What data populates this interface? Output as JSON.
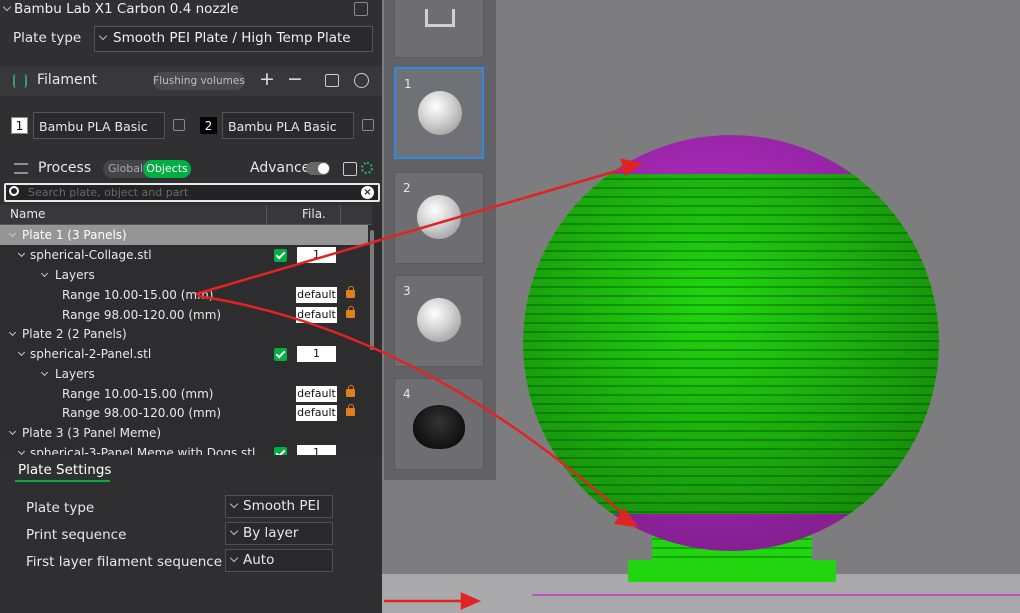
{
  "printer": {
    "name": "Bambu Lab X1 Carbon 0.4 nozzle"
  },
  "plate_type_row": {
    "label": "Plate type",
    "value": "Smooth PEI Plate / High Temp Plate"
  },
  "filament": {
    "title": "Filament",
    "flushing_label": "Flushing volumes",
    "add_symbol": "+",
    "remove_symbol": "−",
    "slots": [
      {
        "num": "1",
        "name": "Bambu PLA Basic",
        "color": "#ffffff"
      },
      {
        "num": "2",
        "name": "Bambu PLA Basic",
        "color": "#000000"
      }
    ]
  },
  "process": {
    "title": "Process",
    "global_label": "Global",
    "objects_label": "Objects",
    "advanced_label": "Advance"
  },
  "search": {
    "placeholder": "Search plate, object and part"
  },
  "tree": {
    "col_name": "Name",
    "col_fila": "Fila.",
    "rows": [
      {
        "text": "Plate 1 (3 Panels)"
      },
      {
        "text": "spherical-Collage.stl",
        "fila": "1"
      },
      {
        "text": "Layers"
      },
      {
        "text": "Range 10.00-15.00 (mm)",
        "fila": "default"
      },
      {
        "text": "Range 98.00-120.00 (mm)",
        "fila": "default"
      },
      {
        "text": "Plate 2 (2 Panels)"
      },
      {
        "text": "spherical-2-Panel.stl",
        "fila": "1"
      },
      {
        "text": "Layers"
      },
      {
        "text": "Range 10.00-15.00 (mm)",
        "fila": "default"
      },
      {
        "text": "Range 98.00-120.00 (mm)",
        "fila": "default"
      },
      {
        "text": "Plate 3 (3 Panel Meme)"
      },
      {
        "text": "spherical-3-Panel Meme with Dogs.stl",
        "fila": "1"
      }
    ]
  },
  "plate_settings": {
    "tab": "Plate Settings",
    "rows": [
      {
        "label": "Plate type",
        "value": "Smooth PEI ..."
      },
      {
        "label": "Print sequence",
        "value": "By layer"
      },
      {
        "label": "First layer filament sequence",
        "value": "Auto"
      }
    ]
  },
  "plates": [
    {
      "num": "1",
      "active": true
    },
    {
      "num": "2",
      "active": false
    },
    {
      "num": "3",
      "active": false
    },
    {
      "num": "4",
      "active": false
    }
  ],
  "colors": {
    "accent": "#00ae42",
    "model_green": "#22d60f",
    "model_magenta": "#c42fd8",
    "arrow_red": "#e02424",
    "selection_blue": "#2e8be0"
  }
}
